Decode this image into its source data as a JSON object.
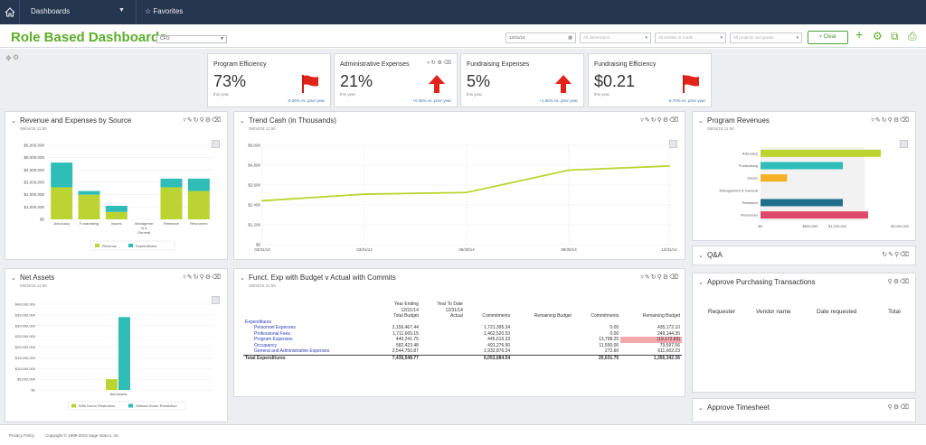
{
  "topbar": {
    "dashboards": "Dashboards",
    "favorites": "Favorites"
  },
  "title": {
    "text": "Role Based Dashboards",
    "role": "CFO"
  },
  "filters": {
    "date": "12/31/14",
    "dimensions": "All dimensions",
    "entities": "All entities or funds",
    "projects": "All projects and grants",
    "clear": "Clear"
  },
  "kpis": [
    {
      "title": "Program Efficiency",
      "value": "73%",
      "period": "this year",
      "comparison": "-0.26% vs. prior year",
      "indicator": "flag"
    },
    {
      "title": "Administrative Expenses",
      "value": "21%",
      "period": "this year",
      "comparison": "+0.35% vs. prior year",
      "indicator": "arrow-up"
    },
    {
      "title": "Fundraising Expenses",
      "value": "5%",
      "period": "this year",
      "comparison": "+1.85% vs. prior year",
      "indicator": "arrow-up"
    },
    {
      "title": "Fundraising Efficiency",
      "value": "$0.21",
      "period": "this year",
      "comparison": "-8.70% vs. prior year",
      "indicator": "flag"
    }
  ],
  "colors": {
    "green": "#5cae2a",
    "lime": "#bcd431",
    "teal": "#2ebdb7",
    "orange": "#f6b122",
    "darkteal": "#1f6f8b",
    "pink": "#df4a6b",
    "red": "#e2231a"
  },
  "panels": {
    "rev": {
      "title": "Revenue and Expenses by Source",
      "date": "09/04/18 11:50"
    },
    "trend": {
      "title": "Trend Cash (in Thousands)",
      "date": "09/04/18 11:50"
    },
    "prog": {
      "title": "Program Revenues",
      "date": "09/04/18 11:50"
    },
    "net": {
      "title": "Net Assets",
      "date": "09/04/18 11:50"
    },
    "funct": {
      "title": "Funct. Exp with Budget v Actual with Commits",
      "date": "09/04/18 11:50"
    },
    "qa": {
      "title": "Q&A"
    },
    "purch": {
      "title": "Approve Purchasing Transactions",
      "cols": [
        "Requester",
        "Vendor name",
        "Date requested",
        "Total"
      ]
    },
    "time": {
      "title": "Approve Timesheet"
    }
  },
  "chart_data": [
    {
      "type": "bar",
      "stacked": true,
      "title": "Revenue and Expenses by Source",
      "categories": [
        "Advocacy",
        "Fundraising",
        "Issues",
        "Management & General",
        "Research",
        "Resources"
      ],
      "yticks": [
        "$6,000,000",
        "$5,000,000",
        "$4,000,000",
        "$3,000,000",
        "$2,000,000",
        "$1,000,000",
        "$0"
      ],
      "ylim": [
        0,
        6000000
      ],
      "series": [
        {
          "name": "Revenue",
          "values": [
            2600000,
            2000000,
            600000,
            0,
            2600000,
            2300000
          ]
        },
        {
          "name": "Expenditures",
          "values": [
            2000000,
            300000,
            500000,
            0,
            700000,
            1000000
          ]
        }
      ],
      "legend": "bottom"
    },
    {
      "type": "line",
      "title": "Trend Cash (in Thousands)",
      "x": [
        "03/31/13",
        "03/31/14",
        "06/30/14",
        "09/30/14",
        "12/31/14"
      ],
      "y": [
        2650,
        3050,
        3150,
        4500,
        4750
      ],
      "yticks": [
        "$6,000",
        "$4,800",
        "$3,600",
        "$2,400",
        "$1,200",
        "$0"
      ],
      "ylim": [
        0,
        6000
      ]
    },
    {
      "type": "bar",
      "orientation": "horizontal",
      "title": "Program Revenues",
      "categories": [
        "Advocacy",
        "Fundraising",
        "Issues",
        "Management & General",
        "Research",
        "Resources"
      ],
      "values": [
        1900000,
        1300000,
        420000,
        0,
        1300000,
        1700000
      ],
      "xticks": [
        "$0",
        "$600,000",
        "$1,200,000",
        "$3,000,000"
      ]
    },
    {
      "type": "bar",
      "title": "Net Assets",
      "categories": [
        "Net Assets"
      ],
      "yticks": [
        "$40,000,000",
        "$35,000,000",
        "$30,000,000",
        "$25,000,000",
        "$20,000,000",
        "$15,000,000",
        "$10,000,000",
        "$5,000,000",
        "$0"
      ],
      "ylim": [
        0,
        40000000
      ],
      "series": [
        {
          "name": "With Donor Restriction",
          "values": [
            5000000
          ]
        },
        {
          "name": "Without Donor Restriction",
          "values": [
            34000000
          ]
        }
      ],
      "legend": "bottom"
    },
    {
      "type": "table",
      "title": "Funct. Exp with Budget v Actual with Commits",
      "header1": [
        "",
        "Year Ending",
        "Year To Date",
        "",
        "",
        "",
        ""
      ],
      "header2": [
        "",
        "12/31/14",
        "12/31/14",
        "",
        "",
        "",
        ""
      ],
      "header3": [
        "",
        "Total Budget",
        "Actual",
        "Commitments",
        "Remaining Budget",
        "Commitments",
        "Remaining Budget"
      ],
      "rows": [
        {
          "label": "Expenditures",
          "cells": [
            "",
            "",
            "",
            "",
            "",
            ""
          ]
        },
        {
          "label": "Personnel Expenses",
          "cells": [
            "2,156,467.44",
            "",
            "1,721,395.34",
            "",
            "0.00",
            "435,172.10"
          ],
          "link": true
        },
        {
          "label": "Professional Fees",
          "cells": [
            "1,711,665.15",
            "",
            "1,462,520.53",
            "",
            "0.00",
            "249,144.35"
          ],
          "link": true
        },
        {
          "label": "Program Expenses",
          "cells": [
            "440,241.75",
            "",
            "445,616.33",
            "",
            "13,798.25",
            "(19,172.83)"
          ],
          "link": true,
          "hl": true
        },
        {
          "label": "Occupancy",
          "cells": [
            "582,423.48",
            "",
            "491,276.50",
            "",
            "11,550.00",
            "79,597.56"
          ],
          "link": true
        },
        {
          "label": "General and Administrative Expenses",
          "cells": [
            "2,544,750.87",
            "",
            "1,932,876.24",
            "",
            "272.60",
            "611,602.23"
          ],
          "link": true
        },
        {
          "label": "Total Expenditures",
          "cells": [
            "7,435,548.77",
            "",
            "6,053,684.54",
            "",
            "25,631.75",
            "1,356,342.36"
          ],
          "total": true
        }
      ]
    }
  ],
  "footer": {
    "privacy": "Privacy Policy",
    "copyright": "Copyright © 1999-2018 Sage Intacct, Inc."
  }
}
